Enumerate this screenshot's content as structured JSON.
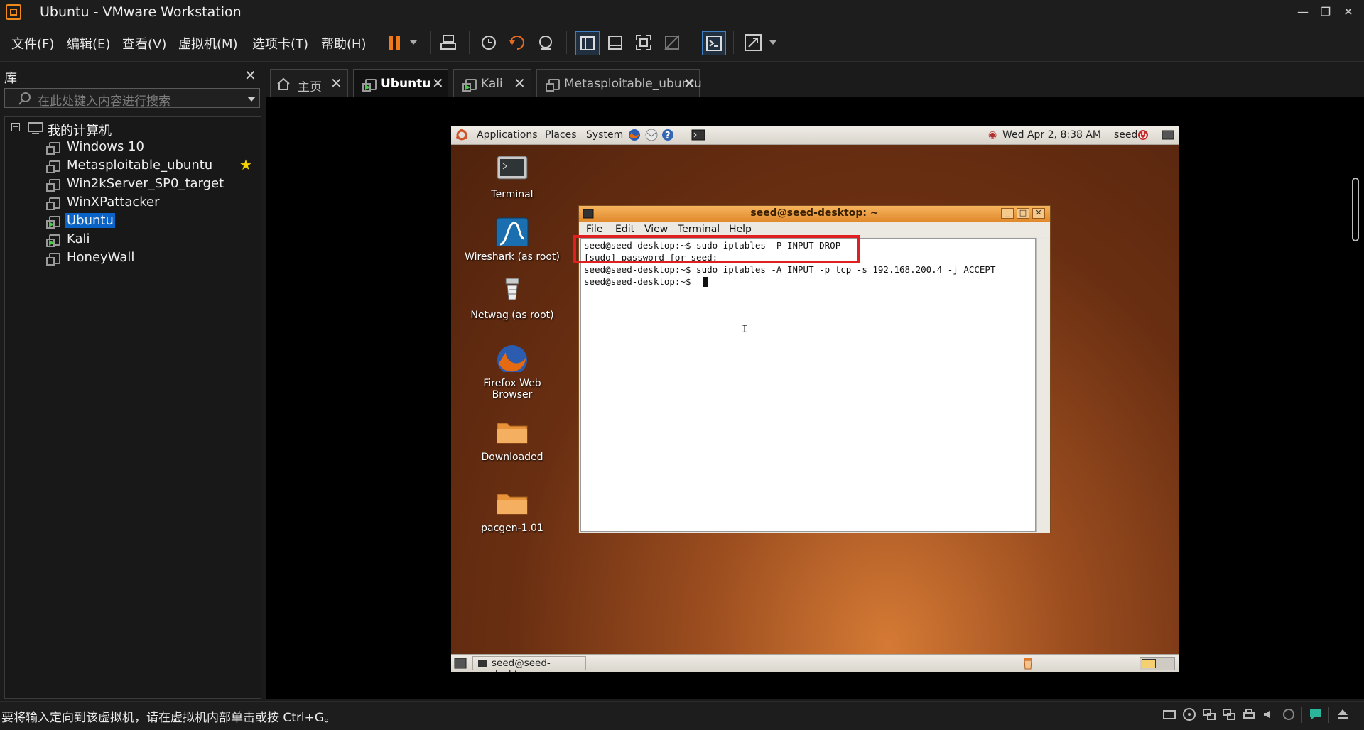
{
  "window": {
    "title": "Ubuntu - VMware Workstation"
  },
  "menu": [
    "文件(F)",
    "编辑(E)",
    "查看(V)",
    "虚拟机(M)",
    "选项卡(T)",
    "帮助(H)"
  ],
  "library": {
    "header": "库",
    "search_placeholder": "在此处键入内容进行搜索",
    "root": "我的计算机",
    "items": [
      "Windows 10",
      "Metasploitable_ubuntu",
      "Win2kServer_SP0_target",
      "WinXPattacker",
      "Ubuntu",
      "Kali",
      "HoneyWall"
    ],
    "selected": "Ubuntu",
    "favorite": "Metasploitable_ubuntu"
  },
  "tabs": [
    {
      "label": "主页",
      "icon": "home-icon"
    },
    {
      "label": "Ubuntu",
      "icon": "vm-running-icon",
      "active": true
    },
    {
      "label": "Kali",
      "icon": "vm-running-icon"
    },
    {
      "label": "Metasploitable_ubuntu",
      "icon": "vm-icon"
    }
  ],
  "guest": {
    "panel": {
      "applications": "Applications",
      "places": "Places",
      "system": "System",
      "datetime": "Wed Apr  2,  8:38 AM",
      "user": "seed"
    },
    "desktop_icons": [
      "Terminal",
      "Wireshark (as root)",
      "Netwag (as root)",
      "Firefox Web Browser",
      "Downloaded",
      "pacgen-1.01"
    ],
    "taskbar_item": "seed@seed-desktop: ~",
    "terminal": {
      "title": "seed@seed-desktop: ~",
      "menu": [
        "File",
        "Edit",
        "View",
        "Terminal",
        "Help"
      ],
      "lines": [
        "seed@seed-desktop:~$ sudo iptables -P INPUT DROP",
        "[sudo] password for seed:",
        "seed@seed-desktop:~$ sudo iptables -A INPUT -p tcp -s 192.168.200.4 -j ACCEPT",
        "seed@seed-desktop:~$ "
      ]
    }
  },
  "status": {
    "message": "要将输入定向到该虚拟机，请在虚拟机内部单击或按 Ctrl+G。"
  },
  "colors": {
    "accent": "#f08a1c",
    "highlight": "#e02020",
    "selection": "#0a64c8"
  }
}
